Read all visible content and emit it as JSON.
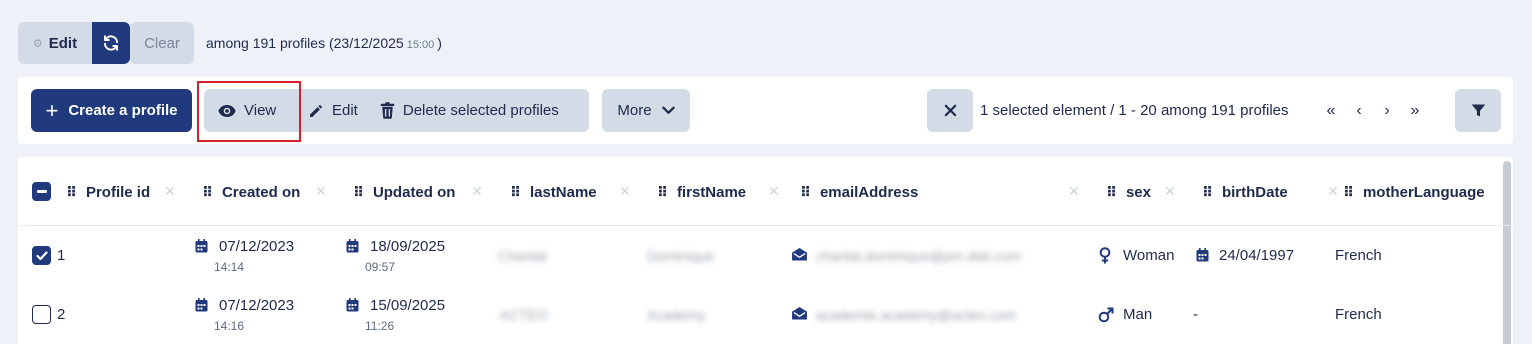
{
  "filter_bar": {
    "edit_label": "Edit",
    "clear_label": "Clear",
    "summary": "among 191 profiles (23/12/2025",
    "summary_time": "15:00",
    "summary_close": ")"
  },
  "toolbar": {
    "create_label": "Create a profile",
    "view_label": "View",
    "edit_label": "Edit",
    "delete_label": "Delete selected profiles",
    "more_label": "More",
    "selection_info": "1 selected element / 1 - 20 among 191 profiles"
  },
  "table": {
    "columns": [
      "Profile id",
      "Created on",
      "Updated on",
      "lastName",
      "firstName",
      "emailAddress",
      "sex",
      "birthDate",
      "motherLanguage"
    ],
    "rows": [
      {
        "id": "1",
        "selected": true,
        "created_date": "07/12/2023",
        "created_time": "14:14",
        "updated_date": "18/09/2025",
        "updated_time": "09:57",
        "last_name": "Chantal",
        "first_name": "Dominique",
        "email": "chantal.dominique@pm.deb.com",
        "sex": "Woman",
        "birth_date": "24/04/1997",
        "mother_language": "French"
      },
      {
        "id": "2",
        "selected": false,
        "created_date": "07/12/2023",
        "created_time": "14:16",
        "updated_date": "15/09/2025",
        "updated_time": "11:26",
        "last_name": "ACTEO",
        "first_name": "Academy",
        "email": "academie.academy@acteo.com",
        "sex": "Man",
        "birth_date": "-",
        "mother_language": "French"
      }
    ]
  },
  "colors": {
    "primary": "#213a7d",
    "button_bg": "#d3dce6",
    "page_bg": "#eef1f7",
    "highlight": "#d6202c"
  }
}
